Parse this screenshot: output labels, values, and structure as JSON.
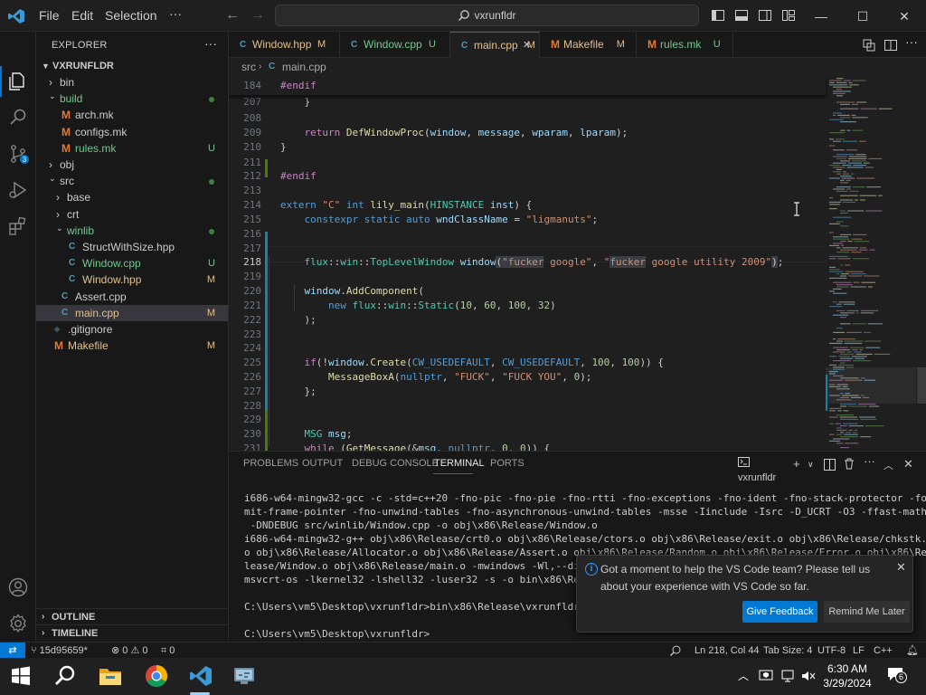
{
  "window": {
    "menu": [
      "File",
      "Edit",
      "Selection"
    ],
    "more": "···",
    "back": "←",
    "forward": "→",
    "search": "vxrunfldr",
    "minimize": "—",
    "maximize": "☐",
    "close": "✕"
  },
  "sidebar": {
    "title": "EXPLORER",
    "more": "···",
    "root": "VXRUNFLDR",
    "tree": [
      {
        "label": "bin",
        "type": "folder",
        "open": false,
        "depth": 1
      },
      {
        "label": "build",
        "type": "folder",
        "open": true,
        "depth": 1,
        "color": "#73c991",
        "dot": true
      },
      {
        "label": "arch.mk",
        "type": "make",
        "depth": 2
      },
      {
        "label": "configs.mk",
        "type": "make",
        "depth": 2
      },
      {
        "label": "rules.mk",
        "type": "make",
        "depth": 2,
        "color": "#73c991",
        "badge": "U"
      },
      {
        "label": "obj",
        "type": "folder",
        "open": false,
        "depth": 1
      },
      {
        "label": "src",
        "type": "folder",
        "open": true,
        "depth": 1,
        "dot": true
      },
      {
        "label": "base",
        "type": "folder",
        "open": false,
        "depth": 2
      },
      {
        "label": "crt",
        "type": "folder",
        "open": false,
        "depth": 2
      },
      {
        "label": "winlib",
        "type": "folder",
        "open": true,
        "depth": 2,
        "color": "#73c991",
        "dot": true
      },
      {
        "label": "StructWithSize.hpp",
        "type": "cpp",
        "depth": 3
      },
      {
        "label": "Window.cpp",
        "type": "cpp",
        "depth": 3,
        "color": "#73c991",
        "badge": "U"
      },
      {
        "label": "Window.hpp",
        "type": "cpp",
        "depth": 3,
        "color": "#e2c08d",
        "badge": "M"
      },
      {
        "label": "Assert.cpp",
        "type": "cpp",
        "depth": 2
      },
      {
        "label": "main.cpp",
        "type": "cpp",
        "depth": 2,
        "color": "#e2c08d",
        "badge": "M",
        "selected": true
      },
      {
        "label": ".gitignore",
        "type": "git",
        "depth": 1
      },
      {
        "label": "Makefile",
        "type": "make",
        "depth": 1,
        "color": "#e2c08d",
        "badge": "M"
      }
    ],
    "outline": "OUTLINE",
    "timeline": "TIMELINE"
  },
  "tabs": [
    {
      "label": "Window.hpp",
      "status": "M",
      "icon": "C",
      "active": false,
      "color": "#e2c08d"
    },
    {
      "label": "Window.cpp",
      "status": "U",
      "icon": "C",
      "active": false,
      "color": "#73c991"
    },
    {
      "label": "main.cpp",
      "status": "M",
      "icon": "C",
      "active": true,
      "color": "#e2c08d",
      "close": "✕"
    },
    {
      "label": "Makefile",
      "status": "M",
      "icon": "M",
      "active": false,
      "color": "#e2c08d"
    },
    {
      "label": "rules.mk",
      "status": "U",
      "icon": "M",
      "active": false,
      "color": "#73c991"
    }
  ],
  "breadcrumb": [
    "src",
    "main.cpp"
  ],
  "editor": {
    "sticky_line": "184",
    "line_numbers": [
      "207",
      "208",
      "209",
      "210",
      "211",
      "212",
      "213",
      "214",
      "215",
      "216",
      "217",
      "218",
      "219",
      "220",
      "221",
      "222",
      "223",
      "224",
      "225",
      "226",
      "227",
      "228",
      "229",
      "230",
      "231"
    ],
    "current_line": "218"
  },
  "panel": {
    "tabs": [
      "PROBLEMS",
      "OUTPUT",
      "DEBUG CONSOLE",
      "TERMINAL",
      "PORTS"
    ],
    "active_tab": "TERMINAL",
    "terminal_name": "vxrunfldr",
    "terminal": "i686-w64-mingw32-gcc -c -std=c++20 -fno-pic -fno-pie -fno-rtti -fno-exceptions -fno-ident -fno-stack-protector -fo\nmit-frame-pointer -fno-unwind-tables -fno-asynchronous-unwind-tables -msse -Iinclude -Isrc -D_UCRT -O3 -ffast-math\n -DNDEBUG src/winlib/Window.cpp -o obj\\x86\\Release/Window.o\ni686-w64-mingw32-g++ obj\\x86\\Release/crt0.o obj\\x86\\Release/ctors.o obj\\x86\\Release/exit.o obj\\x86\\Release/chkstk.\no obj\\x86\\Release/Allocator.o obj\\x86\\Release/Assert.o obj\\x86\\Release/Random.o obj\\x86\\Release/Error.o obj\\x86\\Re\nlease/Window.o obj\\x86\\Release/main.o -mwindows -Wl,--disable\nmsvcrt-os -lkernel32 -lshell32 -luser32 -s -o bin\\x86\\Release\n\nC:\\Users\\vm5\\Desktop\\vxrunfldr>bin\\x86\\Release\\vxrunfldr.exe\n\nC:\\Users\\vm5\\Desktop\\vxrunfldr>"
  },
  "notification": {
    "message": "Got a moment to help the VS Code team? Please tell us about your experience with VS Code so far.",
    "primary": "Give Feedback",
    "secondary": "Remind Me Later",
    "close": "✕"
  },
  "status": {
    "remote": "⇄",
    "branch": "15d95659*",
    "errors": "0",
    "warnings": "0",
    "ports": "0",
    "cursor": "Ln 218, Col 44",
    "indent": "Tab Size: 4",
    "encoding": "UTF-8",
    "eol": "LF",
    "language": "C++"
  },
  "taskbar": {
    "time": "6:30 AM",
    "date": "3/29/2024",
    "notifications": "6"
  },
  "colors": {
    "accent": "#0078d4",
    "modified": "#e2c08d",
    "untracked": "#73c991"
  }
}
